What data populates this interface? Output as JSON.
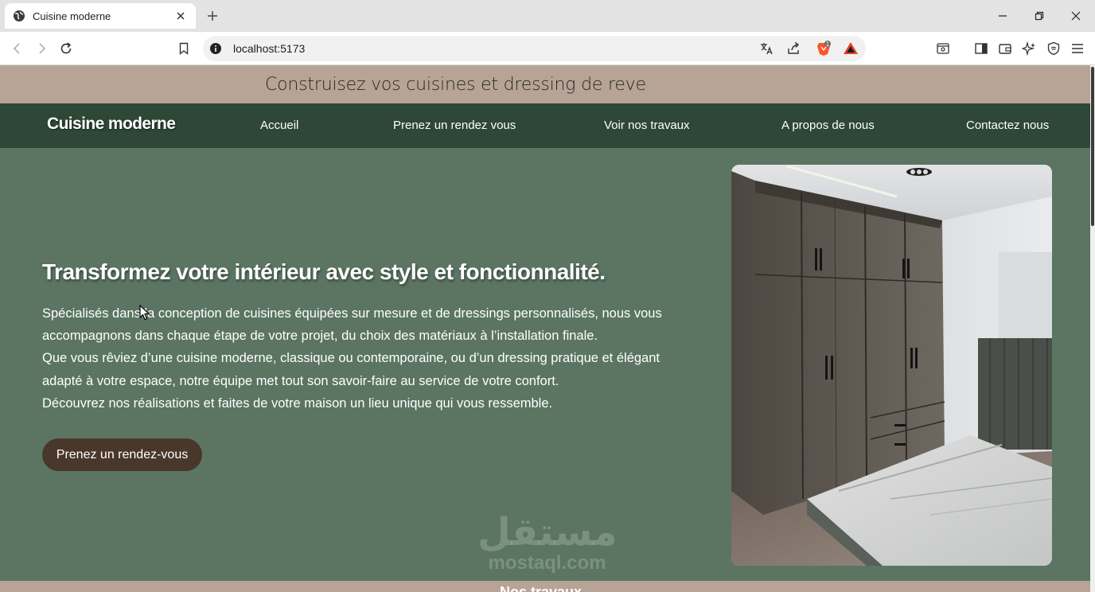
{
  "browser": {
    "tab_title": "Cuisine moderne",
    "url": "localhost:5173",
    "shields_count": "1"
  },
  "site": {
    "banner": "Construisez vos cuisines et dressing de reve",
    "brand": "Cuisine moderne",
    "nav": [
      {
        "label": "Accueil"
      },
      {
        "label": "Prenez un rendez vous"
      },
      {
        "label": "Voir nos travaux"
      },
      {
        "label": "A propos de nous"
      },
      {
        "label": "Contactez nous"
      }
    ]
  },
  "hero": {
    "title": "Transformez votre intérieur avec style et fonctionnalité.",
    "lines": [
      "Spécialisés dans la conception de cuisines équipées sur mesure et de dressings personnalisés, nous vous",
      "accompagnons dans chaque étape de votre projet, du choix des matériaux à l’installation finale.",
      "Que vous rêviez d’une cuisine moderne, classique ou contemporaine, ou d’un dressing pratique et élégant",
      "adapté à votre espace, notre équipe met tout son savoir-faire au service de votre confort.",
      "Découvrez nos réalisations et faites de votre maison un lieu unique qui vous ressemble."
    ],
    "cta_label": "Prenez un rendez-vous"
  },
  "watermark": {
    "arabic": "مستقل",
    "latin": "mostaql.com"
  },
  "section": {
    "title": "Nos travaux"
  },
  "colors": {
    "hero_bg": "#5b7562",
    "navbar_bg": "#2e4737",
    "banner_bg": "#b7a496",
    "cta_bg": "#4a372b"
  },
  "icons": {
    "favicon": "globe-icon",
    "info": "info-icon",
    "bookmark": "bookmark-icon",
    "translate": "translate-icon",
    "share": "share-icon",
    "brave": "brave-lion-icon",
    "rewards": "brave-rewards-icon"
  }
}
